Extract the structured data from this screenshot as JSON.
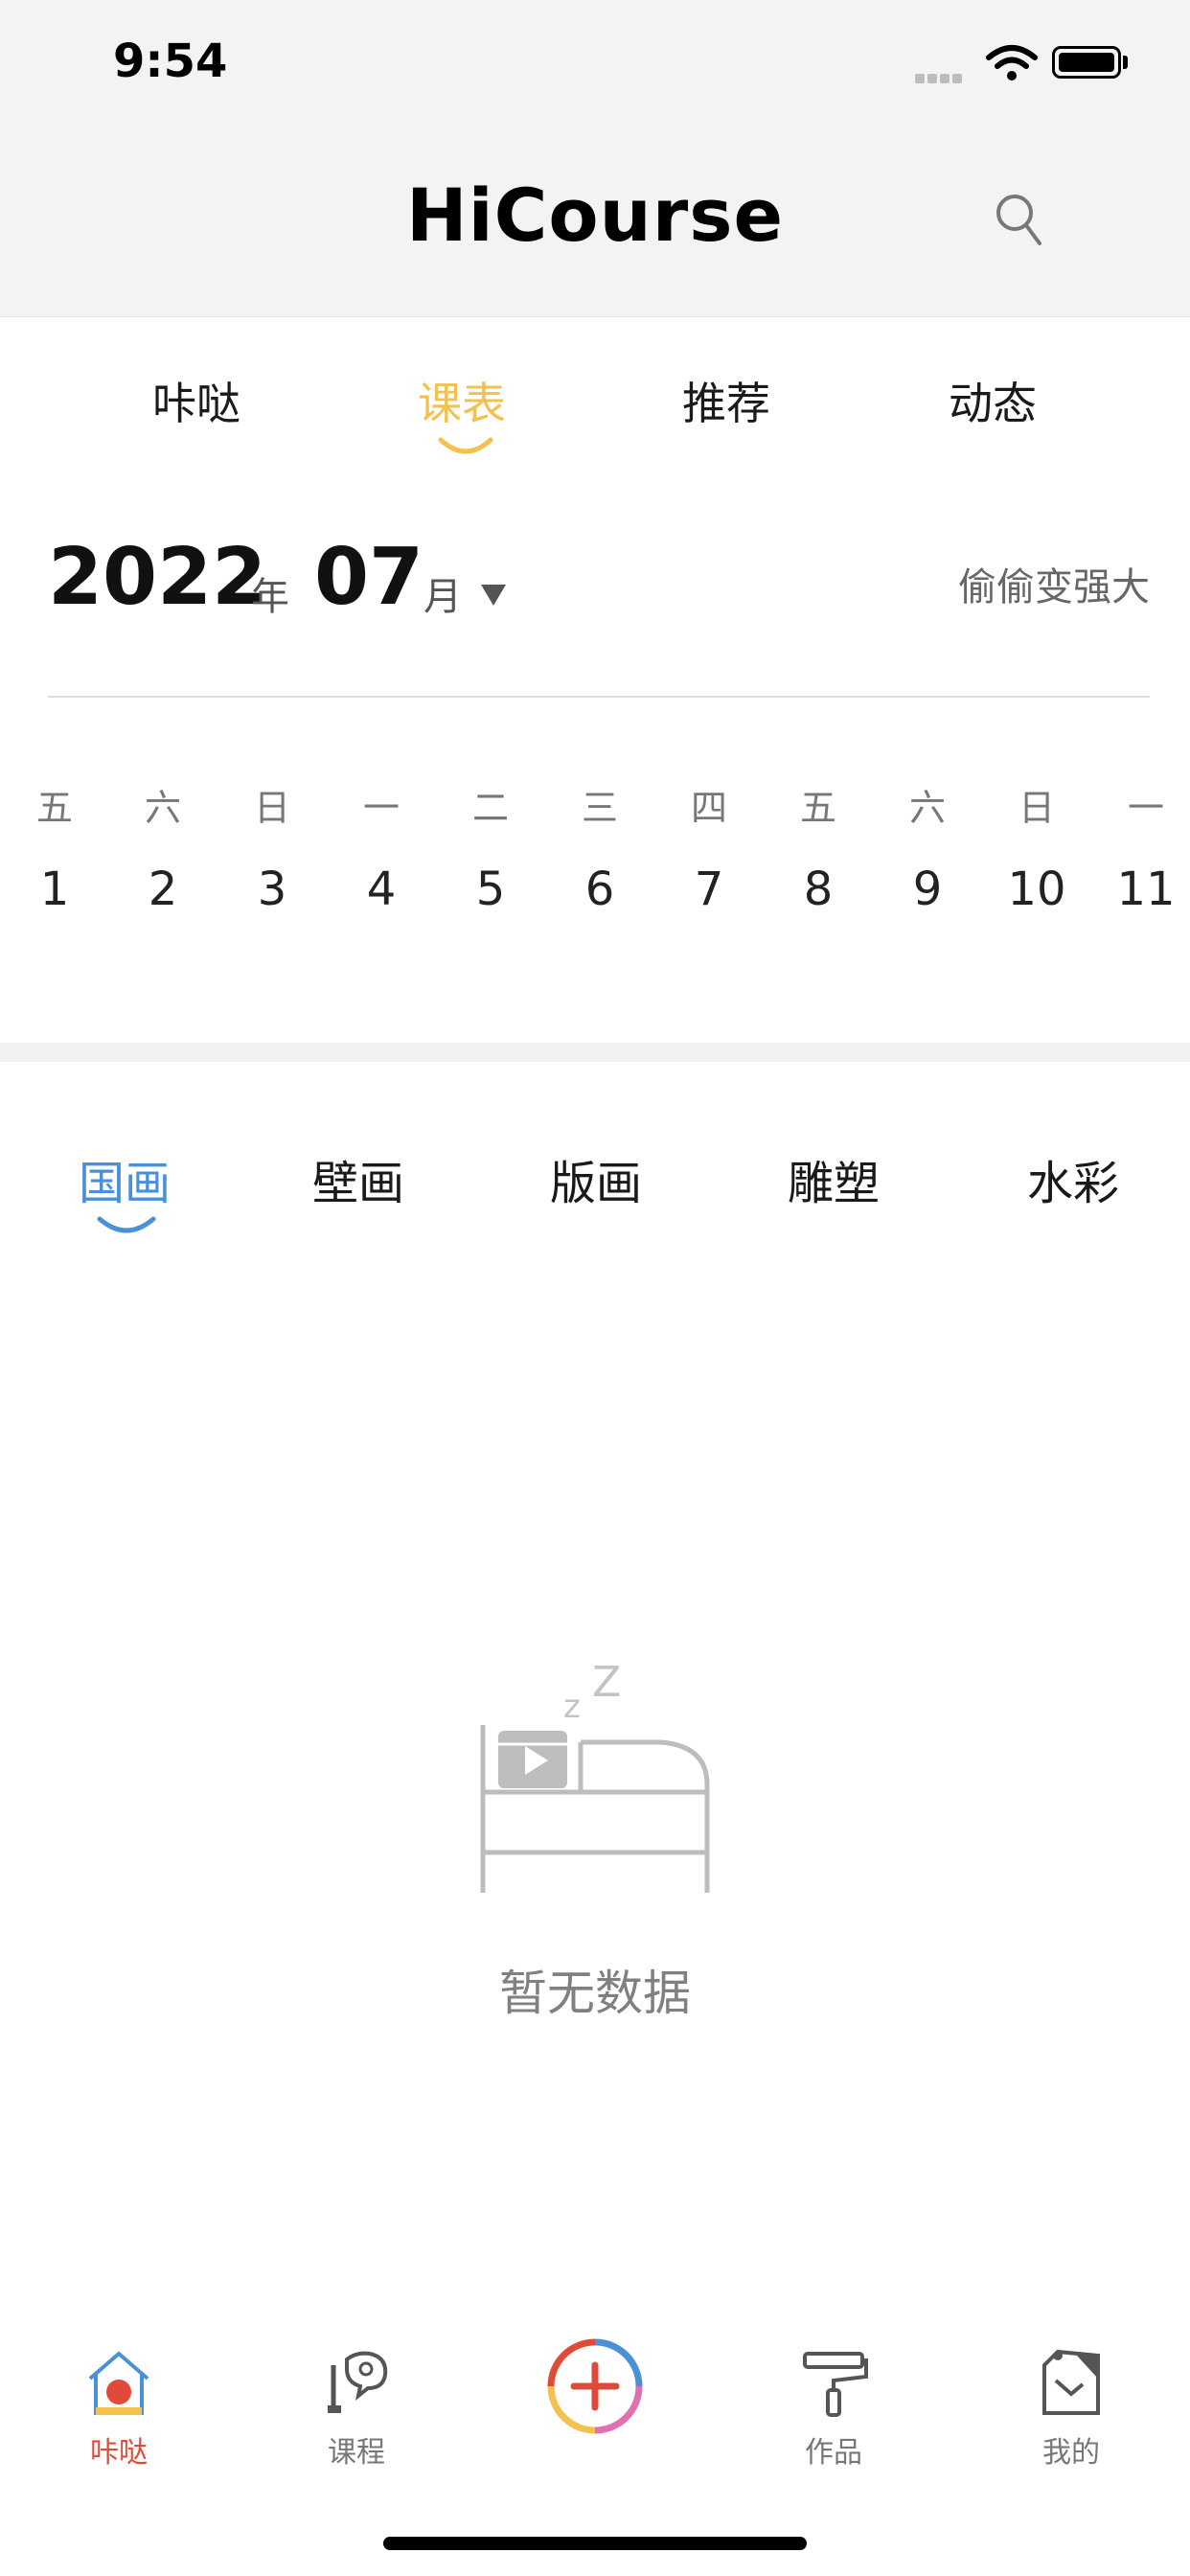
{
  "status_bar": {
    "time": "9:54"
  },
  "header": {
    "title": "HiCourse",
    "search_icon": "search-icon"
  },
  "top_tabs": [
    {
      "label": "咔哒",
      "active": false
    },
    {
      "label": "课表",
      "active": true
    },
    {
      "label": "推荐",
      "active": false
    },
    {
      "label": "动态",
      "active": false
    }
  ],
  "date": {
    "year": "2022",
    "year_unit": "年",
    "month": "07",
    "month_unit": "月",
    "slogan": "偷偷变强大"
  },
  "week_strip": {
    "weekdays": [
      "五",
      "六",
      "日",
      "一",
      "二",
      "三",
      "四",
      "五",
      "六",
      "日",
      "一"
    ],
    "days": [
      "1",
      "2",
      "3",
      "4",
      "5",
      "6",
      "7",
      "8",
      "9",
      "10",
      "11"
    ]
  },
  "category_tabs": [
    {
      "label": "国画",
      "active": true
    },
    {
      "label": "壁画",
      "active": false
    },
    {
      "label": "版画",
      "active": false
    },
    {
      "label": "雕塑",
      "active": false
    },
    {
      "label": "水彩",
      "active": false
    }
  ],
  "empty_state": {
    "text": "暂无数据",
    "icon": "sleeping-bed-icon"
  },
  "bottom_nav": [
    {
      "label": "咔哒",
      "icon": "home-icon",
      "active": true
    },
    {
      "label": "课程",
      "icon": "course-icon",
      "active": false
    },
    {
      "label": "",
      "icon": "add-icon",
      "active": false
    },
    {
      "label": "作品",
      "icon": "paint-roller-icon",
      "active": false
    },
    {
      "label": "我的",
      "icon": "profile-icon",
      "active": false
    }
  ],
  "colors": {
    "header_bg": "#f3f3f3",
    "schedule_tab_active": "#f2c14e",
    "category_tab_active": "#4a90d9",
    "nav_active": "#e04a3a"
  }
}
